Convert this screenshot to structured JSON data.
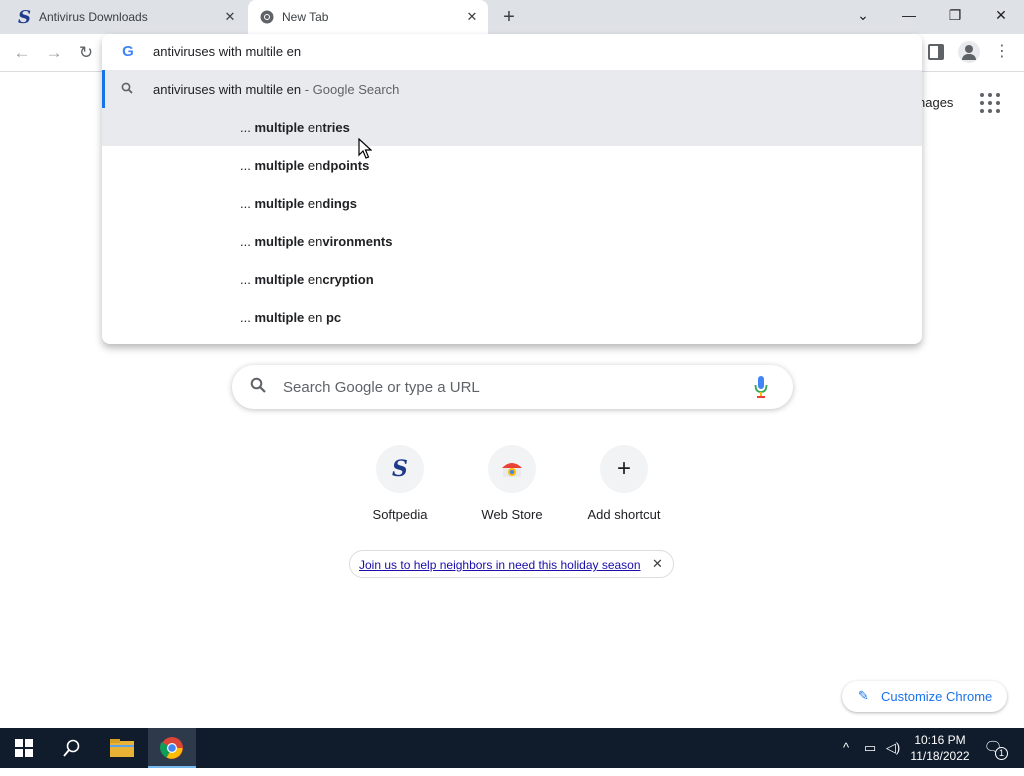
{
  "window": {
    "tabs": [
      {
        "title": "Antivirus Downloads",
        "favicon": "softpedia-icon"
      },
      {
        "title": "New Tab",
        "favicon": "chrome-icon",
        "active": true
      }
    ],
    "controls": {
      "dropdown": "⌄",
      "minimize": "—",
      "maximize": "❐",
      "close": "✕"
    }
  },
  "omnibox": {
    "input_value": "antiviruses with multile en",
    "suggestions": [
      {
        "query": "antiviruses with multile en",
        "suffix": " - Google Search",
        "icon": "search-icon"
      },
      {
        "prefix": "... ",
        "bold1": "multiple",
        "mid": " en",
        "bold2": "tries"
      },
      {
        "prefix": "... ",
        "bold1": "multiple",
        "mid": " en",
        "bold2": "dpoints"
      },
      {
        "prefix": "... ",
        "bold1": "multiple",
        "mid": " en",
        "bold2": "dings"
      },
      {
        "prefix": "... ",
        "bold1": "multiple",
        "mid": " en",
        "bold2": "vironments"
      },
      {
        "prefix": "... ",
        "bold1": "multiple",
        "mid": " en",
        "bold2": "cryption"
      },
      {
        "prefix": "... ",
        "bold1": "multiple",
        "mid": " en ",
        "bold2": "pc"
      }
    ]
  },
  "ntp": {
    "images_link": "nages",
    "search_placeholder": "Search Google or type a URL",
    "shortcuts": [
      {
        "label": "Softpedia",
        "icon": "softpedia-icon"
      },
      {
        "label": "Web Store",
        "icon": "webstore-icon"
      },
      {
        "label": "Add shortcut",
        "icon": "plus-icon"
      }
    ],
    "promo_text": "Join us to help neighbors in need this holiday season",
    "customize_label": "Customize Chrome"
  },
  "taskbar": {
    "time": "10:16 PM",
    "date": "11/18/2022",
    "notification_count": "1"
  },
  "colors": {
    "accent": "#1a73e8",
    "taskbar": "#101c2b",
    "tabstrip": "#dee1e6"
  }
}
